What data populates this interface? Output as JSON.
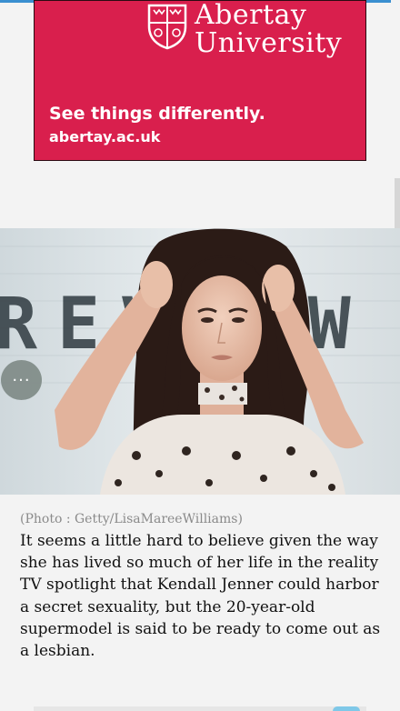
{
  "ad": {
    "university_name": "Abertay\nUniversity",
    "tagline": "See things differently.",
    "url": "abertay.ac.uk",
    "crest_icon": "university-crest-icon",
    "bg_color": "#d91f4d"
  },
  "photo": {
    "caption": "(Photo : Getty/LisaMareeWilliams)",
    "backdrop_text": "REVIEW"
  },
  "article": {
    "paragraph": "It seems a little hard to believe given the way she has lived so much of her life in the reality TV spotlight that Kendall Jenner could harbor a secret sexuality, but the 20-year-old supermodel is said to be ready to come out as a lesbian."
  },
  "fab": {
    "label": "···",
    "icon": "more-options-icon"
  }
}
